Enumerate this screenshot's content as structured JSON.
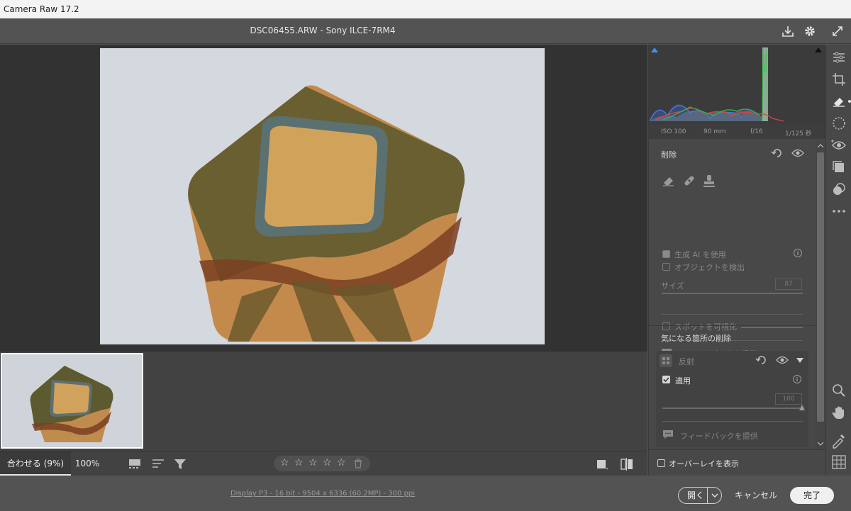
{
  "window": {
    "title": "Camera Raw 17.2"
  },
  "header": {
    "file_title": "DSC06455.ARW  -  Sony ILCE-7RM4"
  },
  "exif": {
    "iso": "ISO 100",
    "focal": "90 mm",
    "aperture": "f/16",
    "shutter": "1/125 秒"
  },
  "remove_panel": {
    "title": "削除",
    "use_gen_ai_label": "生成 AI を使用",
    "detect_objects_label": "オブジェクトを検出",
    "size_label": "サイズ",
    "size_value": "87",
    "visualize_spots_label": "スポットを可視化",
    "feedback_label": "フィードバックを提供"
  },
  "distraction_panel": {
    "title": "気になる箇所の削除",
    "reflection_label": "反射",
    "apply_label": "適用",
    "amount_value": "100",
    "feedback_label": "フィードバックを提供"
  },
  "overlay": {
    "label": "オーバーレイを表示"
  },
  "bottom": {
    "zoom_fit_label": "合わせる (9%)",
    "zoom_100_label": "100%",
    "workflow_link": "Display P3 - 16 bit - 9504 x 6336 (60.2MP) - 300 ppi"
  },
  "actions": {
    "open_label": "開く",
    "cancel_label": "キャンセル",
    "done_label": "完了"
  },
  "rating": {
    "stars": 0,
    "max": 5
  },
  "colors": {
    "panel_bg": "#484848",
    "canvas_bg": "#323232",
    "accent": "#d6d6d6"
  }
}
